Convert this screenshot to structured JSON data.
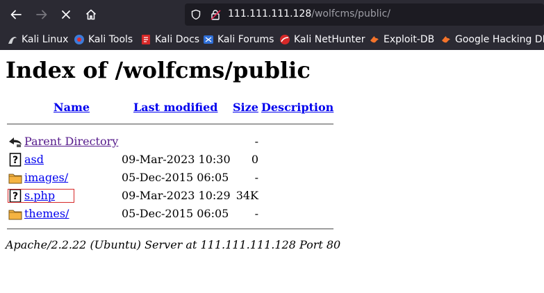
{
  "browser": {
    "url_host": "111.111.111.128",
    "url_path": "/wolfcms/public/",
    "bookmarks": [
      {
        "label": "Kali Linux",
        "icon": "kali-linux-icon"
      },
      {
        "label": "Kali Tools",
        "icon": "kali-tools-icon"
      },
      {
        "label": "Kali Docs",
        "icon": "kali-docs-icon"
      },
      {
        "label": "Kali Forums",
        "icon": "kali-forums-icon"
      },
      {
        "label": "Kali NetHunter",
        "icon": "kali-nethunter-icon"
      },
      {
        "label": "Exploit-DB",
        "icon": "exploit-db-icon"
      },
      {
        "label": "Google Hacking DB",
        "icon": "google-hacking-db-icon"
      }
    ]
  },
  "page": {
    "title": "Index of /wolfcms/public",
    "columns": {
      "name": "Name",
      "last_modified": "Last modified",
      "size": "Size",
      "description": "Description"
    },
    "rows": [
      {
        "name": "Parent Directory",
        "modified": "",
        "size": "-",
        "icon": "back-icon"
      },
      {
        "name": "asd",
        "modified": "09-Mar-2023 10:30",
        "size": "0",
        "icon": "unknown-file-icon"
      },
      {
        "name": "images/",
        "modified": "05-Dec-2015 06:05",
        "size": "-",
        "icon": "folder-icon"
      },
      {
        "name": "s.php",
        "modified": "09-Mar-2023 10:29",
        "size": "34K",
        "icon": "unknown-file-icon"
      },
      {
        "name": "themes/",
        "modified": "05-Dec-2015 06:05",
        "size": "-",
        "icon": "folder-icon"
      }
    ],
    "address": "Apache/2.2.22 (Ubuntu) Server at 111.111.111.128 Port 80"
  }
}
